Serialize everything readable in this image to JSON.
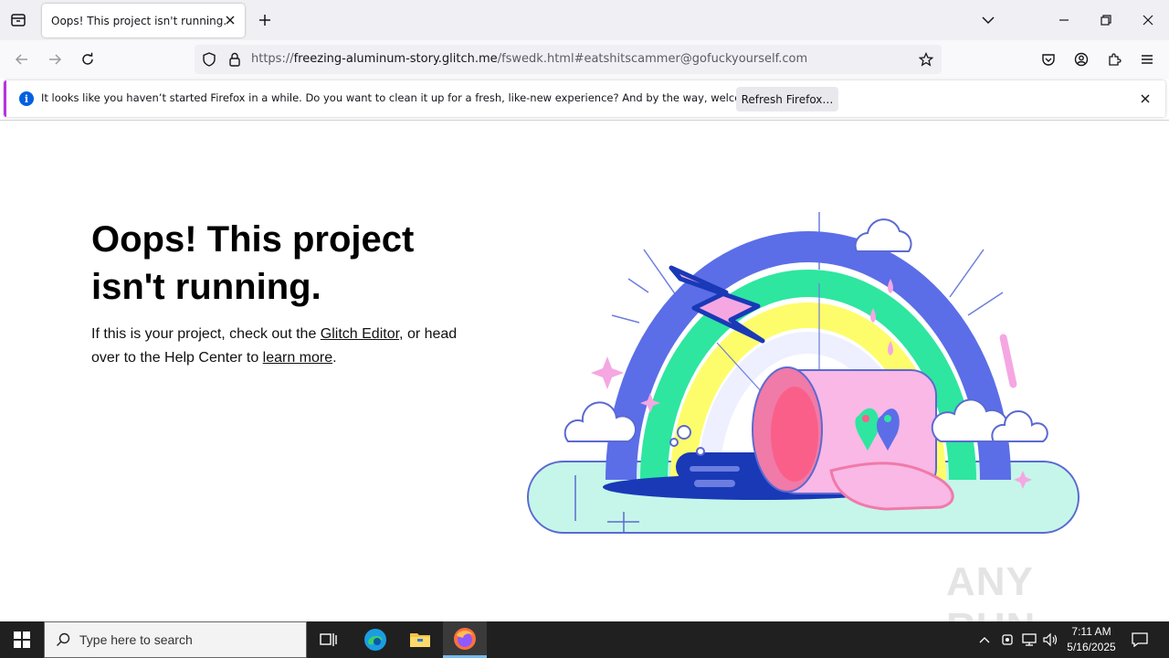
{
  "browser": {
    "tab": {
      "title": "Oops! This project isn't running."
    },
    "url": {
      "scheme": "https://",
      "host": "freezing-aluminum-story.glitch.me",
      "path": "/fswedk.html#eatshitscammer@gofuckyourself.com"
    }
  },
  "notification": {
    "message": "It looks like you haven’t started Firefox in a while. Do you want to clean it up for a fresh, like-new experience? And by the way, welcome back!",
    "button_label": "Refresh Firefox…"
  },
  "page": {
    "heading": "Oops! This project isn't running.",
    "text_before_link1": "If this is your project, check out the ",
    "link1": "Glitch Editor",
    "text_between": ", or head over to the Help Center to ",
    "link2": "learn more",
    "text_after": "."
  },
  "watermark": {
    "text": "ANY RUN"
  },
  "taskbar": {
    "search_placeholder": "Type here to search",
    "time": "7:11 AM",
    "date": "5/16/2025"
  },
  "colors": {
    "accent": "#b833e1",
    "info_blue": "#0060df",
    "taskbar": "#202020"
  }
}
